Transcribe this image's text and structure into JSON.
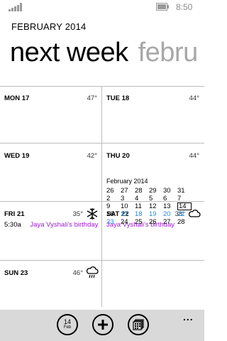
{
  "status_bar": {
    "time": "8:50",
    "signal_icon": "signal-strength-icon",
    "battery_icon": "battery-icon"
  },
  "header": {
    "month_label": "FEBRUARY 2014",
    "pivot_active": "next week",
    "pivot_next": "febru"
  },
  "week": {
    "days": [
      {
        "day": "MON 17",
        "temp": "47°"
      },
      {
        "day": "TUE 18",
        "temp": "44°"
      },
      {
        "day": "WED 19",
        "temp": "42°"
      },
      {
        "day": "THU 20",
        "temp": "44°"
      },
      {
        "day": "FRI 21",
        "temp": "35°",
        "weather_icon": "snow-icon",
        "event": {
          "time": "5:30a",
          "title": "Jaya Vyshali's birthday"
        }
      },
      {
        "day": "SAT 22",
        "temp": "38°",
        "weather_icon": "cloud-icon",
        "event": {
          "title": "Jaya Vyshali's birthday"
        }
      },
      {
        "day": "SUN 23",
        "temp": "46°",
        "weather_icon": "rain-cloud-icon"
      }
    ]
  },
  "mini_month": {
    "title": "February 2014",
    "rows": [
      [
        "26",
        "27",
        "28",
        "29",
        "30",
        "31"
      ],
      [
        "2",
        "3",
        "4",
        "5",
        "6",
        "7"
      ],
      [
        "9",
        "10",
        "11",
        "12",
        "13",
        "14"
      ],
      [
        "16",
        "17",
        "18",
        "19",
        "20",
        "21"
      ],
      [
        "23",
        "24",
        "25",
        "26",
        "27",
        "28"
      ]
    ],
    "blue_cells": [
      "17",
      "18",
      "19",
      "20",
      "21",
      "23"
    ],
    "today": "14"
  },
  "app_bar": {
    "today_day": "14",
    "today_month": "Feb",
    "more_label": "..."
  },
  "colors": {
    "event_color": "#a01ccd",
    "week_highlight": "#1b8be0",
    "app_bar_bg": "#d9d9d9"
  }
}
